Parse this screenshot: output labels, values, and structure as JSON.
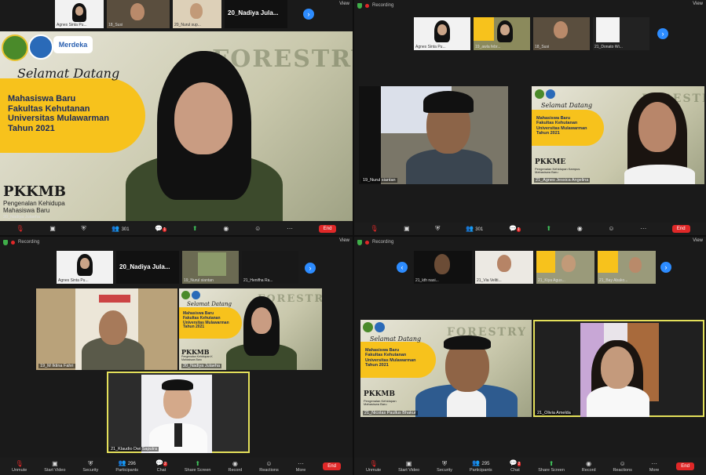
{
  "quadrants": {
    "tl": {
      "strip": [
        {
          "name": "Agnes Sinta Pu..."
        },
        {
          "name": "18_Susi"
        },
        {
          "name": "20_Nurul sup..."
        }
      ],
      "strip_text": "20_Nadiya Jula...",
      "view": "View",
      "slide": {
        "greeting": "Selamat Datang",
        "line1": "Mahasiswa Baru",
        "line2": "Fakultas Kehutanan",
        "line3": "Universitas Mulawarman",
        "line4": "Tahun 2021",
        "pkkmb": "PKKMB",
        "pk_sub1": "Pengenalan Kehidupa",
        "pk_sub2": "Mahasiswa Baru",
        "merdeka": "Merdeka",
        "forestry": "FORESTRY"
      },
      "speaker_name": "20_Nadiya Julaeha",
      "toolbar": {
        "participants": "301",
        "chat_badge": "1",
        "end": "End"
      }
    },
    "tr": {
      "recording": "Recording",
      "view": "View",
      "strip": [
        {
          "name": "Agnes Sinta Pu..."
        },
        {
          "name": "19_awla febr..."
        },
        {
          "name": "18_Susi"
        },
        {
          "name": "21_Donato Wi..."
        }
      ],
      "tiles": [
        {
          "name": "19_Nurul siantan"
        },
        {
          "name": "21_Agnes Jessica Angelina"
        }
      ],
      "slide": {
        "greeting": "Selamat Datang",
        "line1": "Mahasiswa Baru",
        "line2": "Fakultas Kehutanan",
        "line3": "Universitas Mulawarman",
        "line4": "Tahun 2021",
        "pkkmb": "PKKME",
        "pk_sub1": "Pengenalan Kehidupan Kampus",
        "pk_sub2": "Mahasiswa Baru",
        "forestry": "FORESTRY"
      },
      "toolbar": {
        "participants": "301",
        "chat_badge": "1",
        "end": "End"
      }
    },
    "bl": {
      "recording": "Recording",
      "view": "View",
      "strip": [
        {
          "name": "Agnes Sinta Pu..."
        },
        {
          "name": "19_Nurul siantan"
        },
        {
          "name": "21_Henifha Ra..."
        }
      ],
      "strip_text": "20_Nadiya Jula...",
      "tiles": [
        {
          "name": "19_M Iktina Fahri"
        },
        {
          "name": "20_Nadiya Julaeha"
        },
        {
          "name": "21_Klaudio Dwi Saputra"
        }
      ],
      "slide": {
        "greeting": "Selamat Datang",
        "line1": "Mahasiswa Baru",
        "line2": "Fakultas Kehutanan",
        "line3": "Universitas Mulawarman",
        "line4": "Tahun 2021",
        "pkkmb": "PKKMB",
        "pk_sub1": "Pengenalan Kehidupan K",
        "pk_sub2": "Mahasiswa Baru",
        "forestry": "FORESTRY"
      },
      "toolbar": {
        "unmute": "Unmute",
        "start_video": "Start Video",
        "security": "Security",
        "participants_label": "Participants",
        "participants": "296",
        "chat": "Chat",
        "chat_badge": "2",
        "share": "Share Screen",
        "record": "Record",
        "reactions": "Reactions",
        "more": "More",
        "end": "End"
      }
    },
    "br": {
      "recording": "Recording",
      "view": "View",
      "strip": [
        {
          "name": "21_kth nasi..."
        },
        {
          "name": "21_Via Veliti..."
        },
        {
          "name": "21_Kiya Agus..."
        },
        {
          "name": "21_Bay Abako..."
        }
      ],
      "tiles": [
        {
          "name": "21_Nicolas Paullus Bhakur"
        },
        {
          "name": "21_Olivia Amelda"
        }
      ],
      "slide": {
        "greeting": "Selamat Datang",
        "line1": "Mahasiswa Baru",
        "line2": "Fakultas Kehutanan",
        "line3": "Universitas Mulawarman",
        "line4": "Tahun 2021",
        "pkkmb": "PKKMB",
        "pk_sub1": "Pengenalan Kehidupan",
        "pk_sub2": "Mahasiswa Baru",
        "forestry": "FORESTRY"
      },
      "toolbar": {
        "unmute": "Unmute",
        "start_video": "Start Video",
        "security": "Security",
        "participants_label": "Participants",
        "participants": "295",
        "chat": "Chat",
        "chat_badge": "2",
        "share": "Share Screen",
        "record": "Record",
        "reactions": "Reactions",
        "more": "More",
        "end": "End"
      }
    }
  },
  "colors": {
    "accent": "#2d8cff",
    "active_speaker": "#e4e05a",
    "end": "#e02828",
    "share": "#3fc05a",
    "slide_yellow": "#f7c21c"
  }
}
